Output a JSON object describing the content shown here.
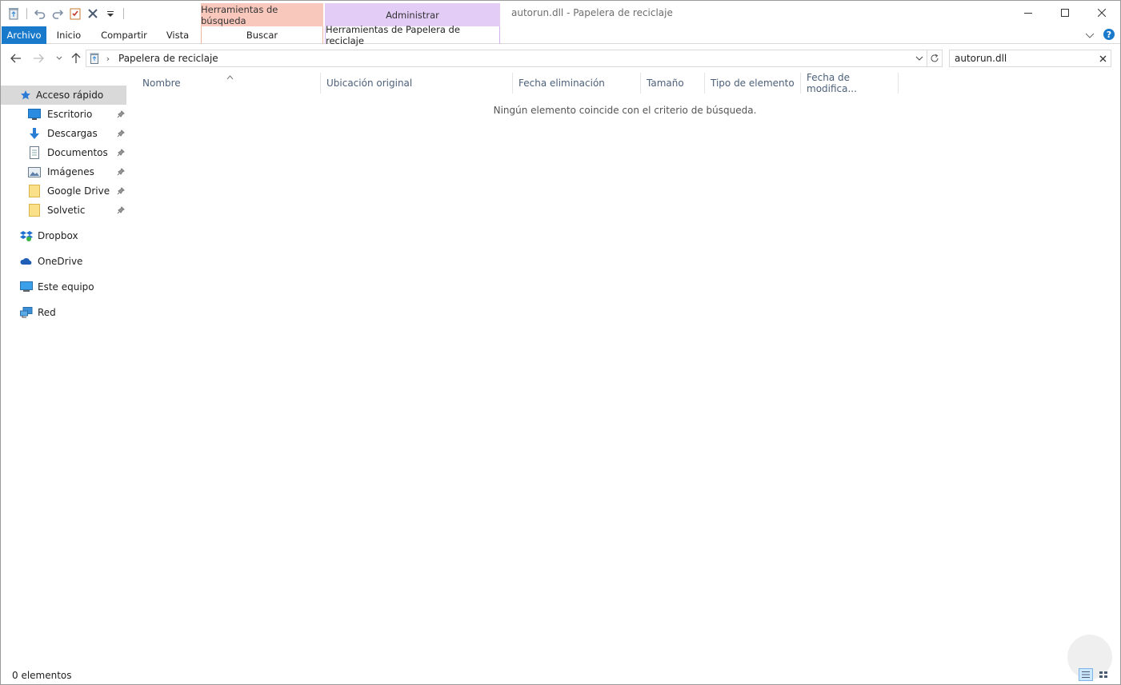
{
  "window": {
    "title": "autorun.dll - Papelera de reciclaje"
  },
  "context_groups": {
    "search_tools": "Herramientas de búsqueda",
    "manage": "Administrar"
  },
  "ribbon": {
    "tabs": [
      "Archivo",
      "Inicio",
      "Compartir",
      "Vista",
      "Buscar",
      "Herramientas de Papelera de reciclaje"
    ]
  },
  "address": {
    "path": "Papelera de reciclaje"
  },
  "search": {
    "value": "autorun.dll"
  },
  "navpane": {
    "quick_access": "Acceso rápido",
    "pinned": [
      "Escritorio",
      "Descargas",
      "Documentos",
      "Imágenes",
      "Google Drive",
      "Solvetic"
    ],
    "roots": [
      "Dropbox",
      "OneDrive",
      "Este equipo",
      "Red"
    ]
  },
  "columns": [
    "Nombre",
    "Ubicación original",
    "Fecha eliminación",
    "Tamaño",
    "Tipo de elemento",
    "Fecha de modifica..."
  ],
  "empty_message": "Ningún elemento coincide con el criterio de búsqueda.",
  "status": {
    "count": "0 elementos"
  },
  "colors": {
    "accent": "#1979ca",
    "search_context": "#f8c8bd",
    "manage_context": "#e3cdf7"
  }
}
